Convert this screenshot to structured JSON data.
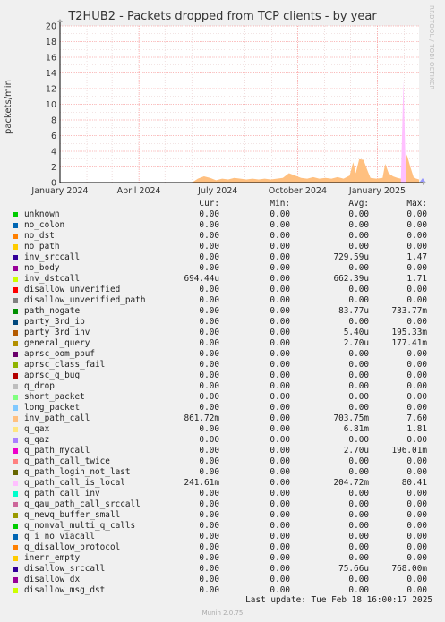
{
  "chart_data": {
    "type": "area",
    "title": "T2HUB2 - Packets dropped from TCP clients - by year",
    "ylabel": "packets/min",
    "ylim": [
      0,
      20
    ],
    "yticks": [
      "0",
      "2",
      "4",
      "6",
      "8",
      "10",
      "12",
      "14",
      "16",
      "18",
      "20"
    ],
    "xticks": [
      "January 2024",
      "April 2024",
      "July 2024",
      "October 2024",
      "January 2025"
    ],
    "xdomain": [
      "2024-01-01",
      "2025-02-18"
    ],
    "grid": true,
    "series": [
      {
        "name": "inv_path_call",
        "color": "#ffc080",
        "points": [
          [
            "2024-06-01",
            0
          ],
          [
            "2024-06-08",
            0.5
          ],
          [
            "2024-06-15",
            0.8
          ],
          [
            "2024-06-22",
            0.6
          ],
          [
            "2024-06-29",
            0.3
          ],
          [
            "2024-07-06",
            0.5
          ],
          [
            "2024-07-13",
            0.4
          ],
          [
            "2024-07-20",
            0.6
          ],
          [
            "2024-07-27",
            0.5
          ],
          [
            "2024-08-03",
            0.4
          ],
          [
            "2024-08-10",
            0.5
          ],
          [
            "2024-08-17",
            0.4
          ],
          [
            "2024-08-24",
            0.5
          ],
          [
            "2024-08-31",
            0.4
          ],
          [
            "2024-09-07",
            0.5
          ],
          [
            "2024-09-14",
            0.6
          ],
          [
            "2024-09-21",
            1.2
          ],
          [
            "2024-09-28",
            0.9
          ],
          [
            "2024-10-05",
            0.6
          ],
          [
            "2024-10-12",
            0.5
          ],
          [
            "2024-10-19",
            0.7
          ],
          [
            "2024-10-26",
            0.5
          ],
          [
            "2024-11-02",
            0.6
          ],
          [
            "2024-11-09",
            0.5
          ],
          [
            "2024-11-16",
            0.7
          ],
          [
            "2024-11-23",
            0.5
          ],
          [
            "2024-11-30",
            0.9
          ],
          [
            "2024-12-04",
            2.6
          ],
          [
            "2024-12-07",
            1.2
          ],
          [
            "2024-12-11",
            3.0
          ],
          [
            "2024-12-16",
            2.9
          ],
          [
            "2024-12-21",
            1.4
          ],
          [
            "2024-12-24",
            0.6
          ],
          [
            "2024-12-31",
            0.5
          ],
          [
            "2025-01-07",
            0.6
          ],
          [
            "2025-01-10",
            2.4
          ],
          [
            "2025-01-14",
            1.2
          ],
          [
            "2025-01-19",
            0.8
          ],
          [
            "2025-01-24",
            0.6
          ],
          [
            "2025-01-28",
            0.5
          ],
          [
            "2025-02-01",
            1.1
          ],
          [
            "2025-02-04",
            3.6
          ],
          [
            "2025-02-08",
            2.0
          ],
          [
            "2025-02-12",
            0.6
          ],
          [
            "2025-02-18",
            0.4
          ]
        ]
      },
      {
        "name": "q_path_call_is_local",
        "color": "#ffc0ff",
        "points": [
          [
            "2025-01-28",
            0
          ],
          [
            "2025-01-31",
            13.0
          ],
          [
            "2025-02-03",
            0
          ]
        ]
      }
    ]
  },
  "legend": {
    "headers": {
      "cur": "Cur:",
      "min": "Min:",
      "avg": "Avg:",
      "max": "Max:"
    },
    "rows": [
      {
        "name": "unknown",
        "color": "#00cc00",
        "cur": "0.00",
        "min": "0.00",
        "avg": "0.00",
        "max": "0.00"
      },
      {
        "name": "no_colon",
        "color": "#0066b3",
        "cur": "0.00",
        "min": "0.00",
        "avg": "0.00",
        "max": "0.00"
      },
      {
        "name": "no_dst",
        "color": "#ff8000",
        "cur": "0.00",
        "min": "0.00",
        "avg": "0.00",
        "max": "0.00"
      },
      {
        "name": "no_path",
        "color": "#ffcc00",
        "cur": "0.00",
        "min": "0.00",
        "avg": "0.00",
        "max": "0.00"
      },
      {
        "name": "inv_srccall",
        "color": "#330099",
        "cur": "0.00",
        "min": "0.00",
        "avg": "729.59u",
        "max": "1.47"
      },
      {
        "name": "no_body",
        "color": "#990099",
        "cur": "0.00",
        "min": "0.00",
        "avg": "0.00",
        "max": "0.00"
      },
      {
        "name": "inv_dstcall",
        "color": "#ccff00",
        "cur": "694.44u",
        "min": "0.00",
        "avg": "662.39u",
        "max": "1.71"
      },
      {
        "name": "disallow_unverified",
        "color": "#ff0000",
        "cur": "0.00",
        "min": "0.00",
        "avg": "0.00",
        "max": "0.00"
      },
      {
        "name": "disallow_unverified_path",
        "color": "#808080",
        "cur": "0.00",
        "min": "0.00",
        "avg": "0.00",
        "max": "0.00"
      },
      {
        "name": "path_nogate",
        "color": "#008f00",
        "cur": "0.00",
        "min": "0.00",
        "avg": "83.77u",
        "max": "733.77m"
      },
      {
        "name": "party_3rd_ip",
        "color": "#00487d",
        "cur": "0.00",
        "min": "0.00",
        "avg": "0.00",
        "max": "0.00"
      },
      {
        "name": "party_3rd_inv",
        "color": "#b35a00",
        "cur": "0.00",
        "min": "0.00",
        "avg": "5.40u",
        "max": "195.33m"
      },
      {
        "name": "general_query",
        "color": "#b38f00",
        "cur": "0.00",
        "min": "0.00",
        "avg": "2.70u",
        "max": "177.41m"
      },
      {
        "name": "aprsc_oom_pbuf",
        "color": "#6b006b",
        "cur": "0.00",
        "min": "0.00",
        "avg": "0.00",
        "max": "0.00"
      },
      {
        "name": "aprsc_class_fail",
        "color": "#8fb300",
        "cur": "0.00",
        "min": "0.00",
        "avg": "0.00",
        "max": "0.00"
      },
      {
        "name": "aprsc_q_bug",
        "color": "#b30000",
        "cur": "0.00",
        "min": "0.00",
        "avg": "0.00",
        "max": "0.00"
      },
      {
        "name": "q_drop",
        "color": "#bebebe",
        "cur": "0.00",
        "min": "0.00",
        "avg": "0.00",
        "max": "0.00"
      },
      {
        "name": "short_packet",
        "color": "#80ff80",
        "cur": "0.00",
        "min": "0.00",
        "avg": "0.00",
        "max": "0.00"
      },
      {
        "name": "long_packet",
        "color": "#80c9ff",
        "cur": "0.00",
        "min": "0.00",
        "avg": "0.00",
        "max": "0.00"
      },
      {
        "name": "inv_path_call",
        "color": "#ffc080",
        "cur": "861.72m",
        "min": "0.00",
        "avg": "703.75m",
        "max": "7.60"
      },
      {
        "name": "q_qax",
        "color": "#ffe680",
        "cur": "0.00",
        "min": "0.00",
        "avg": "6.81m",
        "max": "1.81"
      },
      {
        "name": "q_qaz",
        "color": "#aa80ff",
        "cur": "0.00",
        "min": "0.00",
        "avg": "0.00",
        "max": "0.00"
      },
      {
        "name": "q_path_mycall",
        "color": "#ee00cc",
        "cur": "0.00",
        "min": "0.00",
        "avg": "2.70u",
        "max": "196.01m"
      },
      {
        "name": "q_path_call_twice",
        "color": "#ff8080",
        "cur": "0.00",
        "min": "0.00",
        "avg": "0.00",
        "max": "0.00"
      },
      {
        "name": "q_path_login_not_last",
        "color": "#666600",
        "cur": "0.00",
        "min": "0.00",
        "avg": "0.00",
        "max": "0.00"
      },
      {
        "name": "q_path_call_is_local",
        "color": "#ffbfff",
        "cur": "241.61m",
        "min": "0.00",
        "avg": "204.72m",
        "max": "80.41"
      },
      {
        "name": "q_path_call_inv",
        "color": "#00ffcc",
        "cur": "0.00",
        "min": "0.00",
        "avg": "0.00",
        "max": "0.00"
      },
      {
        "name": "q_qau_path_call_srccall",
        "color": "#cc6699",
        "cur": "0.00",
        "min": "0.00",
        "avg": "0.00",
        "max": "0.00"
      },
      {
        "name": "q_newq_buffer_small",
        "color": "#999900",
        "cur": "0.00",
        "min": "0.00",
        "avg": "0.00",
        "max": "0.00"
      },
      {
        "name": "q_nonval_multi_q_calls",
        "color": "#00cc00",
        "cur": "0.00",
        "min": "0.00",
        "avg": "0.00",
        "max": "0.00"
      },
      {
        "name": "q_i_no_viacall",
        "color": "#0066b3",
        "cur": "0.00",
        "min": "0.00",
        "avg": "0.00",
        "max": "0.00"
      },
      {
        "name": "q_disallow_protocol",
        "color": "#ff8000",
        "cur": "0.00",
        "min": "0.00",
        "avg": "0.00",
        "max": "0.00"
      },
      {
        "name": "inerr_empty",
        "color": "#ffcc00",
        "cur": "0.00",
        "min": "0.00",
        "avg": "0.00",
        "max": "0.00"
      },
      {
        "name": "disallow_srccall",
        "color": "#330099",
        "cur": "0.00",
        "min": "0.00",
        "avg": "75.66u",
        "max": "768.00m"
      },
      {
        "name": "disallow_dx",
        "color": "#990099",
        "cur": "0.00",
        "min": "0.00",
        "avg": "0.00",
        "max": "0.00"
      },
      {
        "name": "disallow_msg_dst",
        "color": "#ccff00",
        "cur": "0.00",
        "min": "0.00",
        "avg": "0.00",
        "max": "0.00"
      }
    ]
  },
  "last_update": "Last update: Tue Feb 18 16:00:17 2025",
  "footer": "Munin 2.0.75",
  "side_label": "RRDTOOL / TOBI OETIKER",
  "colors": {
    "background": "#f0f0f0",
    "plot_bg": "#ffffff",
    "grid_major": "#ff9090",
    "axis": "#000000"
  }
}
